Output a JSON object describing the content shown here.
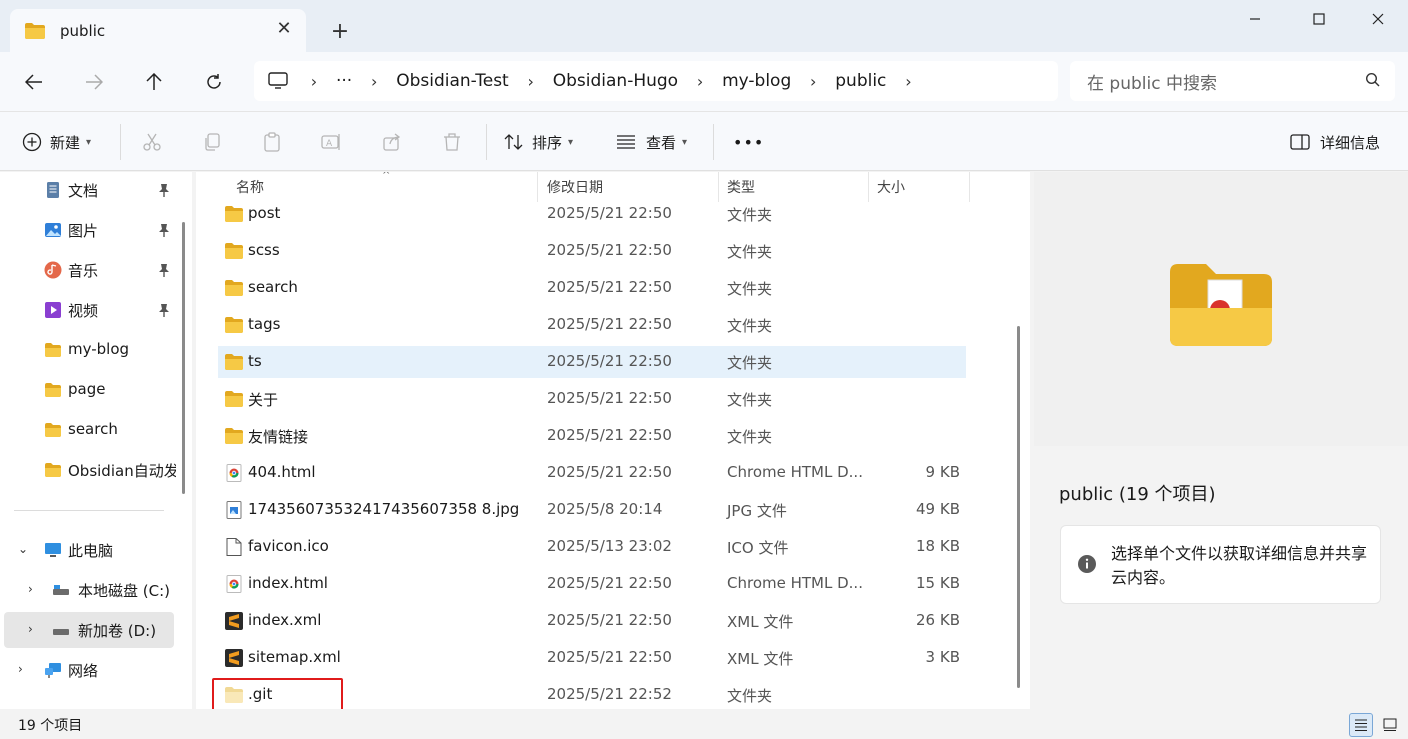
{
  "tab": {
    "title": "public"
  },
  "breadcrumb": [
    "Obsidian-Test",
    "Obsidian-Hugo",
    "my-blog",
    "public"
  ],
  "breadcrumb_more": "···",
  "search": {
    "placeholder": "在 public 中搜索"
  },
  "toolbar": {
    "new_label": "新建",
    "sort_label": "排序",
    "view_label": "查看",
    "more_label": "•••",
    "details_label": "详细信息"
  },
  "nav": {
    "quick_access": [
      {
        "label": "文档",
        "icon": "document-icon",
        "pinned": true
      },
      {
        "label": "图片",
        "icon": "pictures-icon",
        "pinned": true
      },
      {
        "label": "音乐",
        "icon": "music-icon",
        "pinned": true
      },
      {
        "label": "视频",
        "icon": "video-icon",
        "pinned": true
      },
      {
        "label": "my-blog",
        "icon": "folder-icon",
        "pinned": false
      },
      {
        "label": "page",
        "icon": "folder-icon",
        "pinned": false
      },
      {
        "label": "search",
        "icon": "folder-icon",
        "pinned": false
      },
      {
        "label": "Obsidian自动发",
        "icon": "folder-icon",
        "pinned": false
      }
    ],
    "this_pc": "此电脑",
    "drives": [
      {
        "label": "本地磁盘 (C:)",
        "selected": false
      },
      {
        "label": "新加卷 (D:)",
        "selected": true
      }
    ],
    "network": "网络"
  },
  "columns": {
    "name": "名称",
    "date": "修改日期",
    "type": "类型",
    "size": "大小"
  },
  "files": [
    {
      "name": "post",
      "date": "2025/5/21 22:50",
      "type": "文件夹",
      "size": "",
      "icon": "folder-icon"
    },
    {
      "name": "scss",
      "date": "2025/5/21 22:50",
      "type": "文件夹",
      "size": "",
      "icon": "folder-icon"
    },
    {
      "name": "search",
      "date": "2025/5/21 22:50",
      "type": "文件夹",
      "size": "",
      "icon": "folder-icon"
    },
    {
      "name": "tags",
      "date": "2025/5/21 22:50",
      "type": "文件夹",
      "size": "",
      "icon": "folder-icon"
    },
    {
      "name": "ts",
      "date": "2025/5/21 22:50",
      "type": "文件夹",
      "size": "",
      "icon": "folder-icon",
      "selected": true
    },
    {
      "name": "关于",
      "date": "2025/5/21 22:50",
      "type": "文件夹",
      "size": "",
      "icon": "folder-icon"
    },
    {
      "name": "友情链接",
      "date": "2025/5/21 22:50",
      "type": "文件夹",
      "size": "",
      "icon": "folder-icon"
    },
    {
      "name": "404.html",
      "date": "2025/5/21 22:50",
      "type": "Chrome HTML D...",
      "size": "9 KB",
      "icon": "chrome-icon"
    },
    {
      "name": "174356073532417435607358 8.jpg",
      "date": "2025/5/8 20:14",
      "type": "JPG 文件",
      "size": "49 KB",
      "icon": "image-file-icon"
    },
    {
      "name": "favicon.ico",
      "date": "2025/5/13 23:02",
      "type": "ICO 文件",
      "size": "18 KB",
      "icon": "file-icon"
    },
    {
      "name": "index.html",
      "date": "2025/5/21 22:50",
      "type": "Chrome HTML D...",
      "size": "15 KB",
      "icon": "chrome-icon"
    },
    {
      "name": "index.xml",
      "date": "2025/5/21 22:50",
      "type": "XML 文件",
      "size": "26 KB",
      "icon": "sublime-icon"
    },
    {
      "name": "sitemap.xml",
      "date": "2025/5/21 22:50",
      "type": "XML 文件",
      "size": "3 KB",
      "icon": "sublime-icon"
    },
    {
      "name": ".git",
      "date": "2025/5/21 22:52",
      "type": "文件夹",
      "size": "",
      "icon": "folder-hidden-icon"
    }
  ],
  "details": {
    "title": "public (19 个项目)",
    "info": "选择单个文件以获取详细信息并共享云内容。"
  },
  "status": {
    "count": "19 个项目"
  },
  "colors": {
    "folder": "#f3c13a",
    "folder_dark": "#e2a81f",
    "selection": "#e5f1fb",
    "highlight": "#e01b1b",
    "accent": "#0067c0"
  }
}
